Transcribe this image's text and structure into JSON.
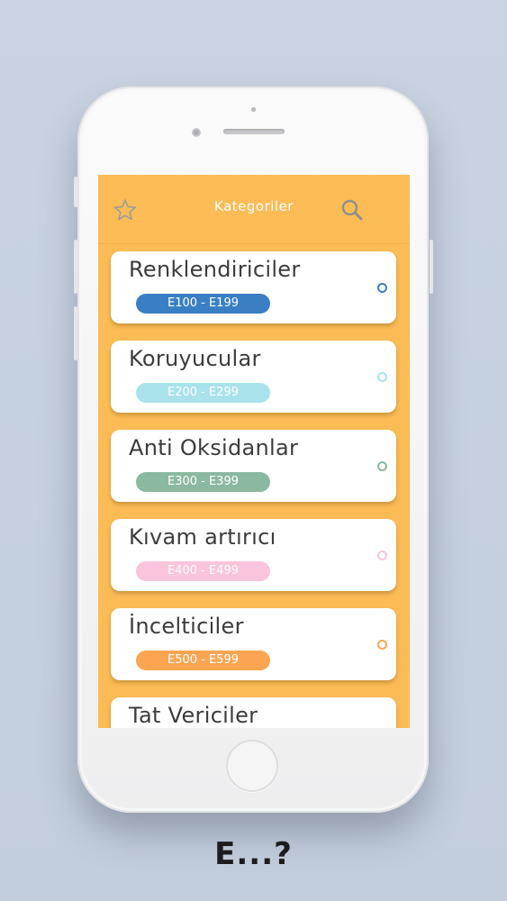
{
  "header": {
    "title": "Kategoriler",
    "left_icon": "star-icon",
    "right_icon": "search-icon"
  },
  "categories": [
    {
      "name": "Renklendiriciler",
      "range": "E100 - E199",
      "color": "#3a7fc4"
    },
    {
      "name": "Koruyucular",
      "range": "E200 - E299",
      "color": "#a9e2ea"
    },
    {
      "name": "Anti Oksidanlar",
      "range": "E300 - E399",
      "color": "#8bb8a0"
    },
    {
      "name": "Kıvam artırıcı",
      "range": "E400 - E499",
      "color": "#fbc4dd"
    },
    {
      "name": "İncelticiler",
      "range": "E500 - E599",
      "color": "#fba552"
    },
    {
      "name": "Tat Vericiler",
      "range": "",
      "color": "#ffffff"
    }
  ],
  "caption": "E...?",
  "colors": {
    "background": "#c6d0de",
    "accent": "#fbbc55",
    "card": "#ffffff"
  }
}
